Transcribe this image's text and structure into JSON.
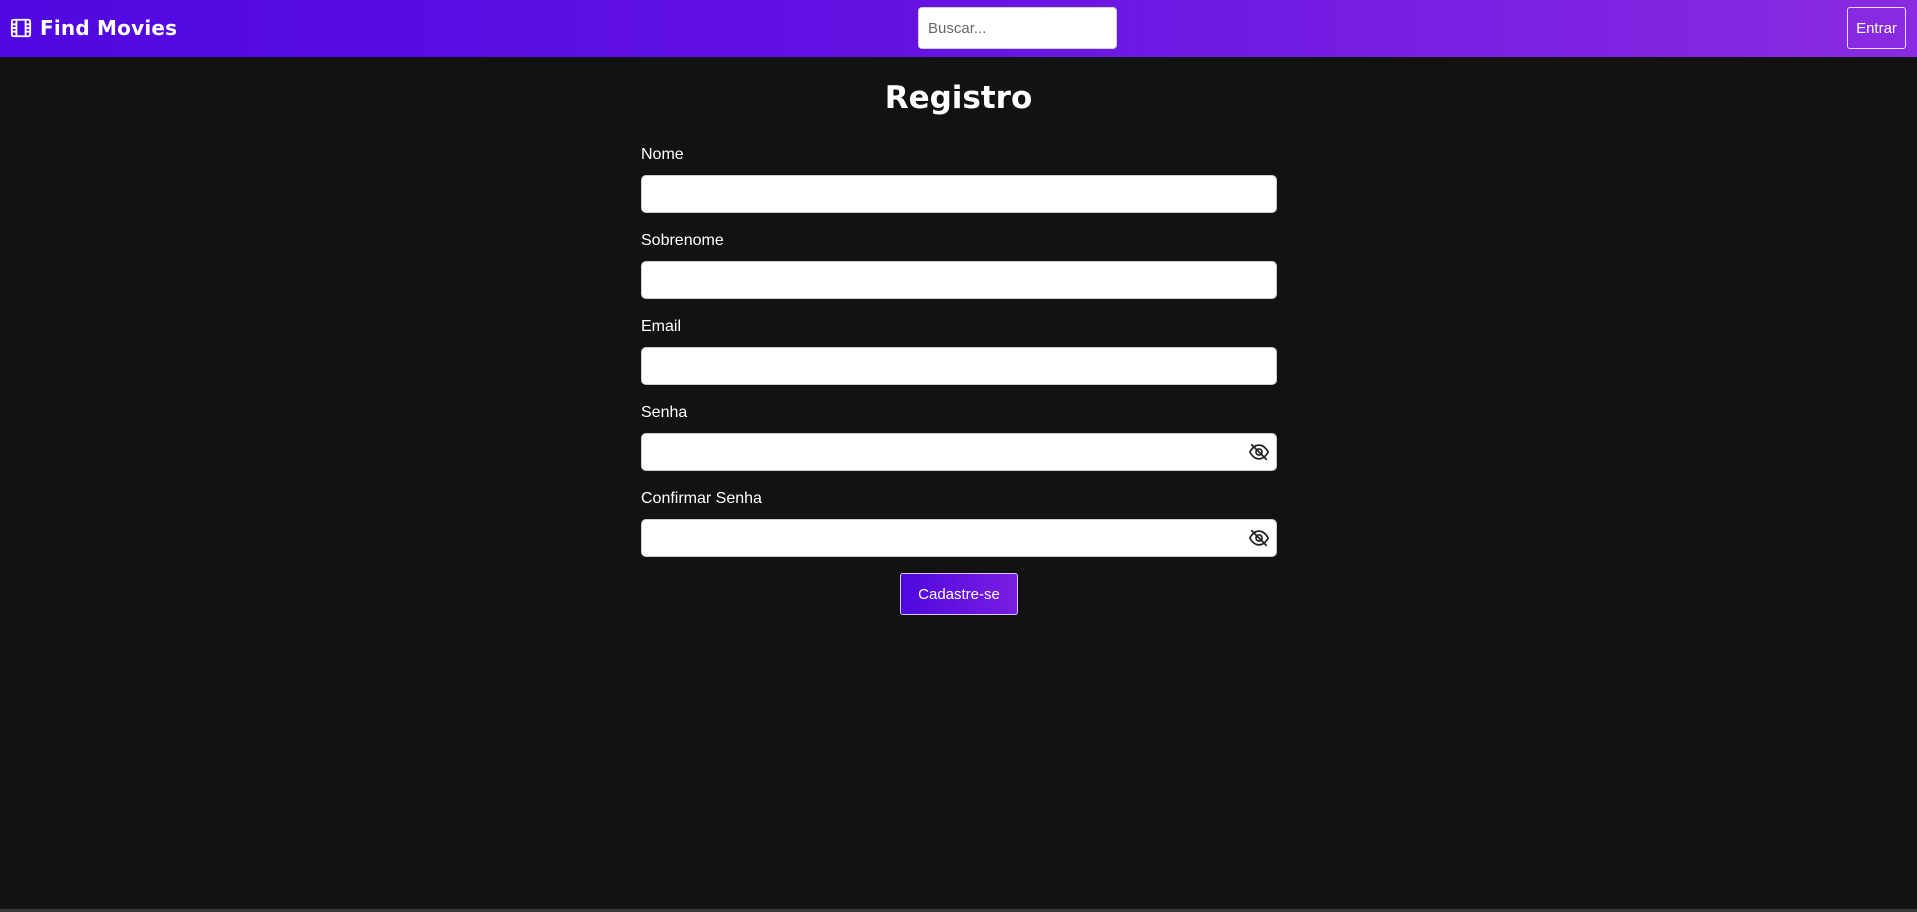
{
  "header": {
    "brand": "Find Movies",
    "brand_icon": "film-icon",
    "search_placeholder": "Buscar...",
    "search_value": "",
    "login_label": "Entrar",
    "gradient_start": "#5008e0",
    "gradient_end": "#8a2be2"
  },
  "form": {
    "title": "Registro",
    "fields": [
      {
        "label": "Nome",
        "value": ""
      },
      {
        "label": "Sobrenome",
        "value": ""
      },
      {
        "label": "Email",
        "value": ""
      },
      {
        "label": "Senha",
        "value": "",
        "toggle_icon": "eye-slash-icon"
      },
      {
        "label": "Confirmar Senha",
        "value": "",
        "toggle_icon": "eye-slash-icon"
      }
    ],
    "submit_label": "Cadastre-se"
  },
  "theme": {
    "background": "#121212",
    "text": "#ffffff"
  }
}
